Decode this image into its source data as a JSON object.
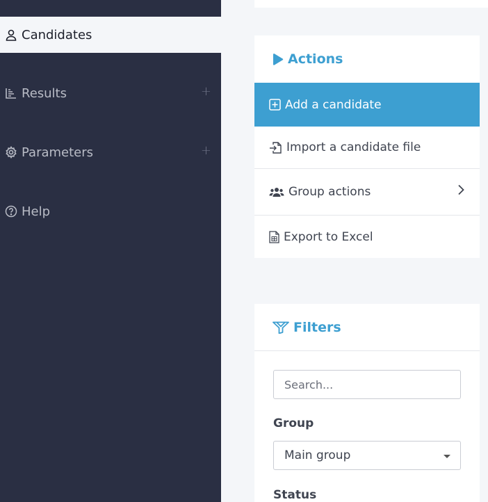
{
  "sidebar": {
    "items": [
      {
        "label": "Candidates",
        "icon": "user-icon",
        "active": true
      },
      {
        "label": "Results",
        "icon": "bar-chart-icon",
        "expandable": true,
        "expand_glyph": "+"
      },
      {
        "label": "Parameters",
        "icon": "gear-icon",
        "expandable": true,
        "expand_glyph": "+"
      },
      {
        "label": "Help",
        "icon": "question-circle-icon"
      }
    ]
  },
  "actions": {
    "title": "Actions",
    "icon": "play-icon",
    "items": [
      {
        "label": "Add a candidate",
        "icon": "plus-square-icon",
        "highlighted": true
      },
      {
        "label": "Import a candidate file",
        "icon": "file-import-icon"
      },
      {
        "label": "Group actions",
        "icon": "users-icon",
        "has_submenu": true
      },
      {
        "label": "Export to Excel",
        "icon": "excel-file-icon"
      }
    ]
  },
  "filters": {
    "title": "Filters",
    "icon": "filter-icon",
    "search": {
      "placeholder": "Search...",
      "value": ""
    },
    "group": {
      "label": "Group",
      "selected": "Main group"
    },
    "status": {
      "label": "Status"
    }
  },
  "colors": {
    "sidebar_bg": "#2a2f43",
    "accent": "#3d9fd1",
    "page_bg": "#f4f6f9"
  }
}
